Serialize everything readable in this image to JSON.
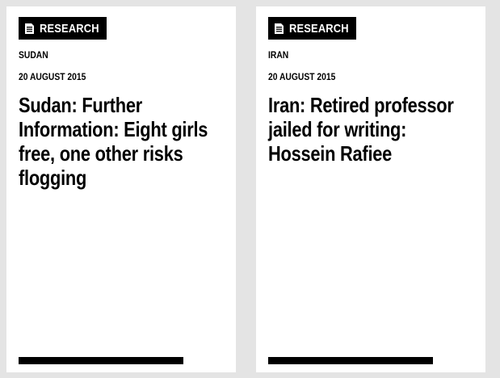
{
  "cards": [
    {
      "badge": {
        "label": "RESEARCH",
        "icon": "document-icon"
      },
      "location": "SUDAN",
      "date": "20 AUGUST 2015",
      "title": "Sudan: Further Information: Eight girls free, one other risks flogging"
    },
    {
      "badge": {
        "label": "RESEARCH",
        "icon": "document-icon"
      },
      "location": "IRAN",
      "date": "20 AUGUST 2015",
      "title": "Iran: Retired professor jailed for writing: Hossein Rafiee"
    }
  ],
  "colors": {
    "background": "#e4e4e4",
    "card": "#ffffff",
    "badge": "#000000",
    "badge_text": "#ffffff",
    "text": "#000000"
  }
}
